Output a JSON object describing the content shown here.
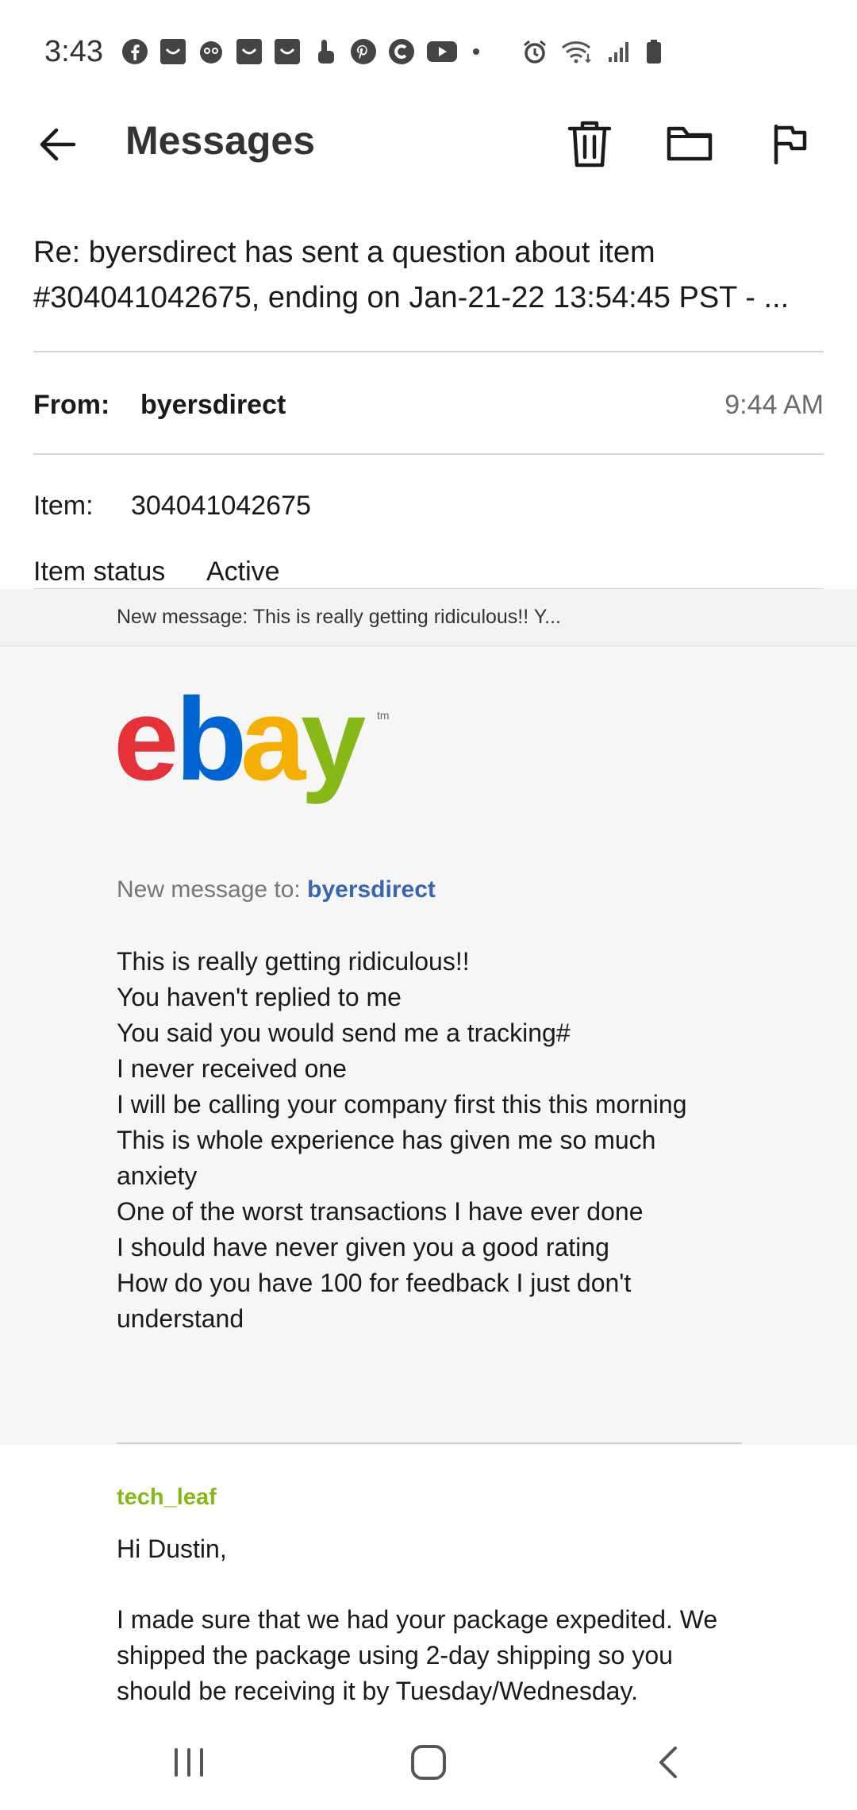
{
  "status_bar": {
    "time": "3:43",
    "left_icons": [
      "facebook-icon",
      "notification-icon",
      "notification-icon",
      "notification-icon",
      "notification-icon",
      "touch-icon",
      "pinterest-icon",
      "app-icon",
      "youtube-icon",
      "dot-icon"
    ],
    "right_icons": [
      "alarm-icon",
      "wifi-icon",
      "signal-icon",
      "battery-icon"
    ]
  },
  "app_bar": {
    "title": "Messages",
    "actions": [
      "trash-icon",
      "folder-icon",
      "flag-icon"
    ]
  },
  "message": {
    "subject": "Re: byersdirect has sent a question about item #304041042675, ending on Jan-21-22 13:54:45 PST - ...",
    "from_label": "From:",
    "from_value": "byersdirect",
    "time": "9:44 AM",
    "item_label": "Item:",
    "item_value": "304041042675",
    "status_label": "Item status",
    "status_value": "Active",
    "preview": "New message: This is really getting ridiculous!! Y..."
  },
  "email": {
    "logo_letters": [
      "e",
      "b",
      "a",
      "y"
    ],
    "logo_tm": "tm",
    "colors": {
      "e": "#e53238",
      "b": "#0064d2",
      "a": "#f5af02",
      "y": "#86b817",
      "link": "#3665b3"
    },
    "to_prefix": "New message to:",
    "to_name": "byersdirect",
    "body_lines": [
      "This is really getting ridiculous!!",
      "You haven't replied to me",
      "You said you would send me a tracking#",
      "I never received one",
      "I will be calling your company first this this morning",
      "This is whole experience has given me so much",
      "anxiety",
      "One of the worst transactions I have ever done",
      "I should have never given you a good rating",
      "How do you have 100 for feedback I just don't",
      "understand"
    ],
    "reply_author": "tech_leaf",
    "reply_greeting": "Hi Dustin,",
    "reply_lines": [
      "I made sure that we had your package expedited. We",
      "shipped the package using 2-day shipping so you",
      "should be receiving it by Tuesday/Wednesday."
    ]
  },
  "nav_bar": {
    "buttons": [
      "recent-apps-icon",
      "home-icon",
      "back-nav-icon"
    ]
  }
}
